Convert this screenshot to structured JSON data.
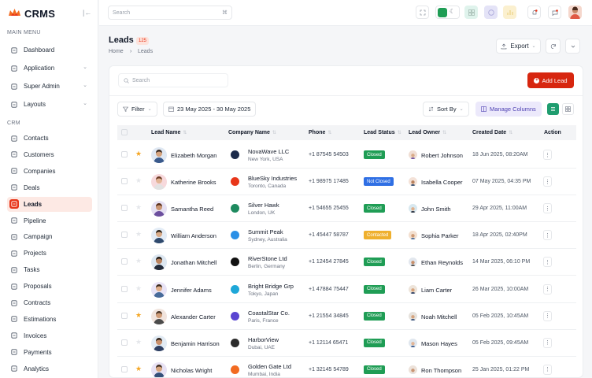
{
  "app": {
    "name": "CRMS"
  },
  "sidebar": {
    "main_menu_title": "MAIN MENU",
    "crm_title": "CRM",
    "main_items": [
      {
        "label": "Dashboard",
        "icon": "dashboard-icon",
        "has_chevron": false
      },
      {
        "label": "Application",
        "icon": "application-icon",
        "has_chevron": true
      },
      {
        "label": "Super Admin",
        "icon": "super-admin-icon",
        "has_chevron": true
      },
      {
        "label": "Layouts",
        "icon": "layouts-icon",
        "has_chevron": true
      }
    ],
    "crm_items": [
      {
        "label": "Contacts",
        "icon": "contacts-icon"
      },
      {
        "label": "Customers",
        "icon": "customers-icon"
      },
      {
        "label": "Companies",
        "icon": "companies-icon"
      },
      {
        "label": "Deals",
        "icon": "deals-icon"
      },
      {
        "label": "Leads",
        "icon": "leads-icon",
        "active": true
      },
      {
        "label": "Pipeline",
        "icon": "pipeline-icon"
      },
      {
        "label": "Campaign",
        "icon": "campaign-icon"
      },
      {
        "label": "Projects",
        "icon": "projects-icon"
      },
      {
        "label": "Tasks",
        "icon": "tasks-icon"
      },
      {
        "label": "Proposals",
        "icon": "proposals-icon"
      },
      {
        "label": "Contracts",
        "icon": "contracts-icon"
      },
      {
        "label": "Estimations",
        "icon": "estimations-icon"
      },
      {
        "label": "Invoices",
        "icon": "invoices-icon"
      },
      {
        "label": "Payments",
        "icon": "payments-icon"
      },
      {
        "label": "Analytics",
        "icon": "analytics-icon"
      }
    ]
  },
  "topbar": {
    "search_placeholder": "Search",
    "search_shortcut": "⌘"
  },
  "page": {
    "title": "Leads",
    "count": "125",
    "breadcrumb": [
      "Home",
      "Leads"
    ],
    "export_label": "Export"
  },
  "toolbar": {
    "search_placeholder": "Search",
    "add_label": "Add Lead",
    "filter_label": "Filter",
    "date_range": "23 May 2025 - 30 May 2025",
    "sort_label": "Sort By",
    "manage_columns_label": "Manage Columns"
  },
  "table": {
    "headers": {
      "name": "Lead Name",
      "company": "Company Name",
      "phone": "Phone",
      "status": "Lead Status",
      "owner": "Lead Owner",
      "created": "Created Date",
      "action": "Action"
    },
    "rows": [
      {
        "name": "Elizabeth Morgan",
        "company": "NovaWave LLC",
        "location": "New York, USA",
        "phone": "+1 87545 54503",
        "status": "Closed",
        "owner": "Robert Johnson",
        "date": "18 Jun 2025, 08:20AM",
        "starred": true
      },
      {
        "name": "Katherine Brooks",
        "company": "BlueSky Industries",
        "location": "Toronto, Canada",
        "phone": "+1 98975 17485",
        "status": "Not Closed",
        "owner": "Isabella Cooper",
        "date": "07 May 2025, 04:35 PM",
        "starred": false
      },
      {
        "name": "Samantha Reed",
        "company": "Silver Hawk",
        "location": "London, UK",
        "phone": "+1 54655 25455",
        "status": "Closed",
        "owner": "John Smith",
        "date": "29 Apr 2025, 11:00AM",
        "starred": false
      },
      {
        "name": "William Anderson",
        "company": "Summit  Peak",
        "location": "Sydney, Australia",
        "phone": "+1 45447 58787",
        "status": "Contacted",
        "owner": "Sophia Parker",
        "date": "18 Apr 2025, 02:40PM",
        "starred": false
      },
      {
        "name": "Jonathan Mitchell",
        "company": "RiverStone Ltd",
        "location": "Berlin, Germany",
        "phone": "+1 12454 27845",
        "status": "Closed",
        "owner": "Ethan Reynolds",
        "date": "14 Mar 2025, 06:10 PM",
        "starred": false
      },
      {
        "name": "Jennifer Adams",
        "company": "Bright Bridge Grp",
        "location": "Tokyo, Japan",
        "phone": "+1 47884 75447",
        "status": "Closed",
        "owner": "Liam Carter",
        "date": "26 Mar 2025, 10:00AM",
        "starred": false
      },
      {
        "name": "Alexander Carter",
        "company": "CoastalStar Co.",
        "location": "Paris, France",
        "phone": "+1 21554 34845",
        "status": "Closed",
        "owner": "Noah Mitchell",
        "date": "05 Feb 2025, 10:45AM",
        "starred": true
      },
      {
        "name": "Benjamin Harrison",
        "company": "HarborView",
        "location": "Dubai, UAE",
        "phone": "+1 12114 65471",
        "status": "Closed",
        "owner": "Mason Hayes",
        "date": "05 Feb 2025, 09:45AM",
        "starred": false
      },
      {
        "name": "Nicholas Wright",
        "company": "Golden Gate Ltd",
        "location": "Mumbai, India",
        "phone": "+1 32145 54789",
        "status": "Closed",
        "owner": "Ron Thompson",
        "date": "25 Jan 2025, 01:22 PM",
        "starred": true
      }
    ]
  },
  "colors": {
    "accent": "#e8361a",
    "primary_button": "#d7260f",
    "status_closed": "#1f9d55",
    "status_not_closed": "#2f6fe4",
    "status_contacted": "#efb02e",
    "star": "#f5a623"
  }
}
